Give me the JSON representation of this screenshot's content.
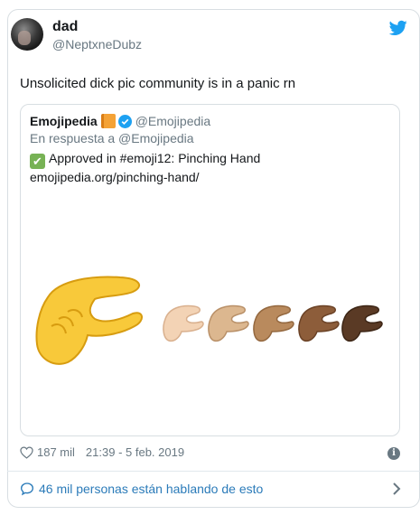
{
  "tweet": {
    "author_name": "dad",
    "author_handle": "@NeptxneDubz",
    "text": "Unsolicited dick pic community is in a panic rn",
    "likes": "187 mil",
    "timestamp": "21:39 - 5 feb. 2019",
    "conversation_label": "46 mil personas están hablando de esto"
  },
  "quoted": {
    "author_name": "Emojipedia",
    "author_handle": "@Emojipedia",
    "reply_to": "En respuesta a @Emojipedia",
    "line1": "Approved in #emoji12: Pinching Hand",
    "line2": "emojipedia.org/pinching-hand/"
  },
  "colors": {
    "link": "#2b7bb9",
    "twitter_blue": "#1da1f2",
    "check_green": "#77b255",
    "skin_tones": [
      "#f8c93a",
      "#f3d3b5",
      "#dcb78f",
      "#b98a5d",
      "#8d5d3a",
      "#5a3a25"
    ]
  },
  "icons": {
    "bird": "twitter-bird-icon",
    "heart": "heart-icon",
    "info": "info-icon",
    "bubble": "speech-bubble-icon",
    "chevron": "chevron-right-icon",
    "verified": "verified-badge-icon",
    "book": "orange-book-icon",
    "check": "check-mark-button-icon"
  }
}
